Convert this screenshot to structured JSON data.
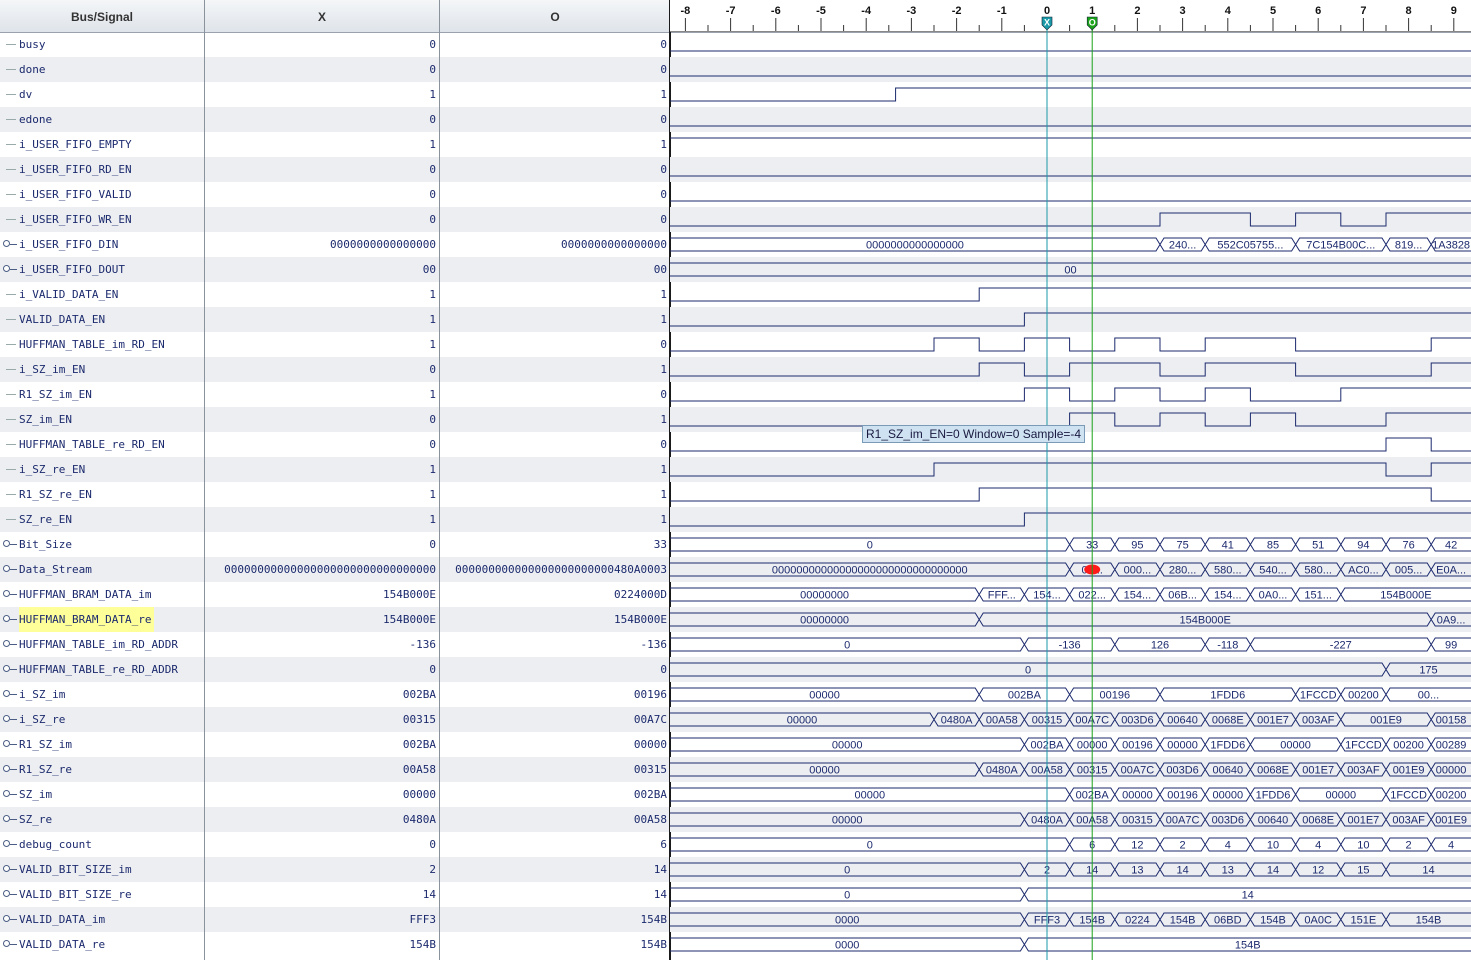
{
  "columns": {
    "signal": "Bus/Signal",
    "x": "X",
    "o": "O"
  },
  "time_ticks": [
    "-8",
    "-7",
    "-6",
    "-5",
    "-4",
    "-3",
    "-2",
    "-1",
    "0",
    "1",
    "2",
    "3",
    "4",
    "5",
    "6",
    "7",
    "8",
    "9"
  ],
  "cursors": {
    "x": {
      "label": "X",
      "at": 0,
      "color": "#1a9aa8"
    },
    "o": {
      "label": "O",
      "at": 1,
      "color": "#1aa21a"
    }
  },
  "tooltip": "R1_SZ_im_EN=0 Window=0 Sample=-4",
  "colors": {
    "wave": "#1c2a6e",
    "text": "#1c2a6e",
    "row_alt": "#eceef1",
    "highlight": "#ffff99",
    "marker": "#ff1a1a"
  },
  "signals": [
    {
      "name": "busy",
      "type": "bit",
      "x": "0",
      "o": "0",
      "wave": [
        [
          -9,
          0
        ]
      ]
    },
    {
      "name": "done",
      "type": "bit",
      "x": "0",
      "o": "0",
      "wave": [
        [
          -9,
          0
        ]
      ]
    },
    {
      "name": "dv",
      "type": "bit",
      "x": "1",
      "o": "1",
      "wave": [
        [
          -9,
          0
        ],
        [
          -3.35,
          1
        ]
      ]
    },
    {
      "name": "edone",
      "type": "bit",
      "x": "0",
      "o": "0",
      "wave": [
        [
          -9,
          0
        ]
      ]
    },
    {
      "name": "i_USER_FIFO_EMPTY",
      "type": "bit",
      "x": "1",
      "o": "1",
      "wave": [
        [
          -9,
          1
        ]
      ]
    },
    {
      "name": "i_USER_FIFO_RD_EN",
      "type": "bit",
      "x": "0",
      "o": "0",
      "wave": [
        [
          -9,
          0
        ]
      ]
    },
    {
      "name": "i_USER_FIFO_VALID",
      "type": "bit",
      "x": "0",
      "o": "0",
      "wave": [
        [
          -9,
          0
        ]
      ]
    },
    {
      "name": "i_USER_FIFO_WR_EN",
      "type": "bit",
      "x": "0",
      "o": "0",
      "wave": [
        [
          -9,
          0
        ],
        [
          2.5,
          1
        ],
        [
          4.5,
          0
        ],
        [
          5.5,
          1
        ],
        [
          6.5,
          0
        ],
        [
          7.5,
          1
        ]
      ]
    },
    {
      "name": "i_USER_FIFO_DIN",
      "type": "bus",
      "x": "0000000000000000",
      "o": "0000000000000000",
      "wave": [
        [
          -9,
          "0000000000000000"
        ],
        [
          2.5,
          "240..."
        ],
        [
          3.5,
          "552C05755..."
        ],
        [
          5.5,
          "7C154B00C..."
        ],
        [
          7.5,
          "819..."
        ],
        [
          8.5,
          "1A3828"
        ]
      ]
    },
    {
      "name": "i_USER_FIFO_DOUT",
      "type": "bus",
      "x": "00",
      "o": "00",
      "wave": [
        [
          -9,
          "00"
        ]
      ]
    },
    {
      "name": "i_VALID_DATA_EN",
      "type": "bit",
      "x": "1",
      "o": "1",
      "wave": [
        [
          -9,
          0
        ],
        [
          -1.5,
          1
        ]
      ]
    },
    {
      "name": "VALID_DATA_EN",
      "type": "bit",
      "x": "1",
      "o": "1",
      "wave": [
        [
          -9,
          0
        ],
        [
          -0.5,
          1
        ]
      ]
    },
    {
      "name": "HUFFMAN_TABLE_im_RD_EN",
      "type": "bit",
      "x": "1",
      "o": "0",
      "wave": [
        [
          -9,
          0
        ],
        [
          -2.5,
          1
        ],
        [
          -1.5,
          0
        ],
        [
          -0.5,
          1
        ],
        [
          0.5,
          0
        ],
        [
          1.5,
          1
        ],
        [
          2.5,
          0
        ],
        [
          3.5,
          1
        ],
        [
          5.5,
          0
        ],
        [
          8.5,
          1
        ]
      ]
    },
    {
      "name": "i_SZ_im_EN",
      "type": "bit",
      "x": "0",
      "o": "1",
      "wave": [
        [
          -9,
          0
        ],
        [
          -1.5,
          1
        ],
        [
          -0.5,
          0
        ],
        [
          0.5,
          1
        ],
        [
          2.5,
          0
        ],
        [
          3.5,
          1
        ],
        [
          5.5,
          0
        ],
        [
          8.5,
          1
        ]
      ]
    },
    {
      "name": "R1_SZ_im_EN",
      "type": "bit",
      "x": "1",
      "o": "0",
      "wave": [
        [
          -9,
          0
        ],
        [
          -0.5,
          1
        ],
        [
          0.5,
          0
        ],
        [
          1.5,
          1
        ],
        [
          2.5,
          0
        ],
        [
          3.5,
          1
        ],
        [
          4.5,
          0
        ],
        [
          6.5,
          1
        ]
      ]
    },
    {
      "name": "SZ_im_EN",
      "type": "bit",
      "x": "0",
      "o": "1",
      "wave": [
        [
          -9,
          0
        ],
        [
          0.5,
          1
        ],
        [
          1.5,
          0
        ],
        [
          2.5,
          1
        ],
        [
          3.5,
          0
        ],
        [
          4.5,
          1
        ],
        [
          5.5,
          0
        ],
        [
          7.5,
          1
        ]
      ]
    },
    {
      "name": "HUFFMAN_TABLE_re_RD_EN",
      "type": "bit",
      "x": "0",
      "o": "0",
      "wave": [
        [
          -9,
          0
        ],
        [
          7.5,
          1
        ],
        [
          8.5,
          0
        ]
      ]
    },
    {
      "name": "i_SZ_re_EN",
      "type": "bit",
      "x": "1",
      "o": "1",
      "wave": [
        [
          -9,
          0
        ],
        [
          -2.5,
          1
        ],
        [
          7.5,
          0
        ],
        [
          8.5,
          1
        ]
      ]
    },
    {
      "name": "R1_SZ_re_EN",
      "type": "bit",
      "x": "1",
      "o": "1",
      "wave": [
        [
          -9,
          0
        ],
        [
          -1.5,
          1
        ],
        [
          8.5,
          0
        ]
      ]
    },
    {
      "name": "SZ_re_EN",
      "type": "bit",
      "x": "1",
      "o": "1",
      "wave": [
        [
          -9,
          0
        ],
        [
          -0.5,
          1
        ]
      ]
    },
    {
      "name": "Bit_Size",
      "type": "bus",
      "x": "0",
      "o": "33",
      "wave": [
        [
          -9,
          "0"
        ],
        [
          0.5,
          "33"
        ],
        [
          1.5,
          "95"
        ],
        [
          2.5,
          "75"
        ],
        [
          3.5,
          "41"
        ],
        [
          4.5,
          "85"
        ],
        [
          5.5,
          "51"
        ],
        [
          6.5,
          "94"
        ],
        [
          7.5,
          "76"
        ],
        [
          8.5,
          "42"
        ]
      ]
    },
    {
      "name": "Data_Stream",
      "type": "bus",
      "x": "00000000000000000000000000000000",
      "o": "000000000000000000000000480A0003",
      "wave": [
        [
          -9,
          "00000000000000000000000000000000"
        ],
        [
          0.5,
          "00..."
        ],
        [
          1.5,
          "000..."
        ],
        [
          2.5,
          "280..."
        ],
        [
          3.5,
          "580..."
        ],
        [
          4.5,
          "540..."
        ],
        [
          5.5,
          "580..."
        ],
        [
          6.5,
          "AC0..."
        ],
        [
          7.5,
          "005..."
        ],
        [
          8.5,
          "E0A..."
        ]
      ]
    },
    {
      "name": "HUFFMAN_BRAM_DATA_im",
      "type": "bus",
      "x": "154B000E",
      "o": "0224000D",
      "wave": [
        [
          -9,
          "00000000"
        ],
        [
          -1.5,
          "FFF..."
        ],
        [
          -0.5,
          "154..."
        ],
        [
          0.5,
          "022..."
        ],
        [
          1.5,
          "154..."
        ],
        [
          2.5,
          "06B..."
        ],
        [
          3.5,
          "154..."
        ],
        [
          4.5,
          "0A0..."
        ],
        [
          5.5,
          "151..."
        ],
        [
          6.5,
          "154B000E"
        ]
      ]
    },
    {
      "name": "HUFFMAN_BRAM_DATA_re",
      "type": "bus",
      "x": "154B000E",
      "o": "154B000E",
      "hl": true,
      "wave": [
        [
          -9,
          "00000000"
        ],
        [
          -1.5,
          "154B000E"
        ],
        [
          8.5,
          "0A9..."
        ]
      ]
    },
    {
      "name": "HUFFMAN_TABLE_im_RD_ADDR",
      "type": "bus",
      "x": "-136",
      "o": "-136",
      "wave": [
        [
          -9,
          "0"
        ],
        [
          -0.5,
          "-136"
        ],
        [
          1.5,
          "126"
        ],
        [
          3.5,
          "-118"
        ],
        [
          4.5,
          "-227"
        ],
        [
          8.5,
          "99"
        ]
      ]
    },
    {
      "name": "HUFFMAN_TABLE_re_RD_ADDR",
      "type": "bus",
      "x": "0",
      "o": "0",
      "wave": [
        [
          -9,
          "0"
        ],
        [
          7.5,
          "175"
        ]
      ]
    },
    {
      "name": "i_SZ_im",
      "type": "bus",
      "x": "002BA",
      "o": "00196",
      "wave": [
        [
          -9,
          "00000"
        ],
        [
          -1.5,
          "002BA"
        ],
        [
          0.5,
          "00196"
        ],
        [
          2.5,
          "1FDD6"
        ],
        [
          5.5,
          "1FCCD"
        ],
        [
          6.5,
          "00200"
        ],
        [
          7.5,
          "00..."
        ]
      ]
    },
    {
      "name": "i_SZ_re",
      "type": "bus",
      "x": "00315",
      "o": "00A7C",
      "wave": [
        [
          -9,
          "00000"
        ],
        [
          -2.5,
          "0480A"
        ],
        [
          -1.5,
          "00A58"
        ],
        [
          -0.5,
          "00315"
        ],
        [
          0.5,
          "00A7C"
        ],
        [
          1.5,
          "003D6"
        ],
        [
          2.5,
          "00640"
        ],
        [
          3.5,
          "0068E"
        ],
        [
          4.5,
          "001E7"
        ],
        [
          5.5,
          "003AF"
        ],
        [
          6.5,
          "001E9"
        ],
        [
          8.5,
          "00158"
        ]
      ]
    },
    {
      "name": "R1_SZ_im",
      "type": "bus",
      "x": "002BA",
      "o": "00000",
      "wave": [
        [
          -9,
          "00000"
        ],
        [
          -0.5,
          "002BA"
        ],
        [
          0.5,
          "00000"
        ],
        [
          1.5,
          "00196"
        ],
        [
          2.5,
          "00000"
        ],
        [
          3.5,
          "1FDD6"
        ],
        [
          4.5,
          "00000"
        ],
        [
          6.5,
          "1FCCD"
        ],
        [
          7.5,
          "00200"
        ],
        [
          8.5,
          "00289"
        ]
      ]
    },
    {
      "name": "R1_SZ_re",
      "type": "bus",
      "x": "00A58",
      "o": "00315",
      "wave": [
        [
          -9,
          "00000"
        ],
        [
          -1.5,
          "0480A"
        ],
        [
          -0.5,
          "00A58"
        ],
        [
          0.5,
          "00315"
        ],
        [
          1.5,
          "00A7C"
        ],
        [
          2.5,
          "003D6"
        ],
        [
          3.5,
          "00640"
        ],
        [
          4.5,
          "0068E"
        ],
        [
          5.5,
          "001E7"
        ],
        [
          6.5,
          "003AF"
        ],
        [
          7.5,
          "001E9"
        ],
        [
          8.5,
          "00000"
        ]
      ]
    },
    {
      "name": "SZ_im",
      "type": "bus",
      "x": "00000",
      "o": "002BA",
      "wave": [
        [
          -9,
          "00000"
        ],
        [
          0.5,
          "002BA"
        ],
        [
          1.5,
          "00000"
        ],
        [
          2.5,
          "00196"
        ],
        [
          3.5,
          "00000"
        ],
        [
          4.5,
          "1FDD6"
        ],
        [
          5.5,
          "00000"
        ],
        [
          7.5,
          "1FCCD"
        ],
        [
          8.5,
          "00200"
        ]
      ]
    },
    {
      "name": "SZ_re",
      "type": "bus",
      "x": "0480A",
      "o": "00A58",
      "wave": [
        [
          -9,
          "00000"
        ],
        [
          -0.5,
          "0480A"
        ],
        [
          0.5,
          "00A58"
        ],
        [
          1.5,
          "00315"
        ],
        [
          2.5,
          "00A7C"
        ],
        [
          3.5,
          "003D6"
        ],
        [
          4.5,
          "00640"
        ],
        [
          5.5,
          "0068E"
        ],
        [
          6.5,
          "001E7"
        ],
        [
          7.5,
          "003AF"
        ],
        [
          8.5,
          "001E9"
        ]
      ]
    },
    {
      "name": "debug_count",
      "type": "bus",
      "x": "0",
      "o": "6",
      "wave": [
        [
          -9,
          "0"
        ],
        [
          0.5,
          "6"
        ],
        [
          1.5,
          "12"
        ],
        [
          2.5,
          "2"
        ],
        [
          3.5,
          "4"
        ],
        [
          4.5,
          "10"
        ],
        [
          5.5,
          "4"
        ],
        [
          6.5,
          "10"
        ],
        [
          7.5,
          "2"
        ],
        [
          8.5,
          "4"
        ]
      ]
    },
    {
      "name": "VALID_BIT_SIZE_im",
      "type": "bus",
      "x": "2",
      "o": "14",
      "wave": [
        [
          -9,
          "0"
        ],
        [
          -0.5,
          "2"
        ],
        [
          0.5,
          "14"
        ],
        [
          1.5,
          "13"
        ],
        [
          2.5,
          "14"
        ],
        [
          3.5,
          "13"
        ],
        [
          4.5,
          "14"
        ],
        [
          5.5,
          "12"
        ],
        [
          6.5,
          "15"
        ],
        [
          7.5,
          "14"
        ]
      ]
    },
    {
      "name": "VALID_BIT_SIZE_re",
      "type": "bus",
      "x": "14",
      "o": "14",
      "wave": [
        [
          -9,
          "0"
        ],
        [
          -0.5,
          "14"
        ]
      ]
    },
    {
      "name": "VALID_DATA_im",
      "type": "bus",
      "x": "FFF3",
      "o": "154B",
      "wave": [
        [
          -9,
          "0000"
        ],
        [
          -0.5,
          "FFF3"
        ],
        [
          0.5,
          "154B"
        ],
        [
          1.5,
          "0224"
        ],
        [
          2.5,
          "154B"
        ],
        [
          3.5,
          "06BD"
        ],
        [
          4.5,
          "154B"
        ],
        [
          5.5,
          "0A0C"
        ],
        [
          6.5,
          "151E"
        ],
        [
          7.5,
          "154B"
        ]
      ]
    },
    {
      "name": "VALID_DATA_re",
      "type": "bus",
      "x": "154B",
      "o": "154B",
      "wave": [
        [
          -9,
          "0000"
        ],
        [
          -0.5,
          "154B"
        ]
      ]
    }
  ],
  "marker": {
    "signal": "Data_Stream",
    "at": 1,
    "shape": "red-dot"
  }
}
